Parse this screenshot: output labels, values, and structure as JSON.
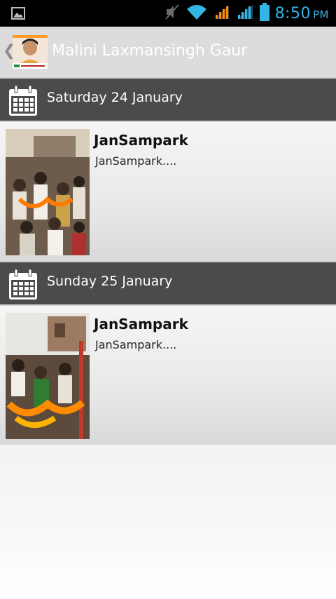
{
  "status_bar": {
    "time": "8:50",
    "ampm": "PM",
    "icons": [
      "gallery-icon",
      "mute-icon",
      "wifi-icon",
      "signal-icon-1",
      "signal-icon-2",
      "battery-icon"
    ],
    "accent_color": "#33b5e5"
  },
  "action_bar": {
    "title": "Malini Laxmansingh Gaur",
    "back_icon": "chevron-left-icon",
    "app_icon": "profile-avatar"
  },
  "feed": {
    "sections": [
      {
        "date": "Saturday 24 January",
        "posts": [
          {
            "title": "JanSampark",
            "description": "JanSampark...."
          }
        ]
      },
      {
        "date": "Sunday 25 January",
        "posts": [
          {
            "title": "JanSampark",
            "description": "JanSampark...."
          }
        ]
      }
    ]
  },
  "colors": {
    "header_bg": "#4a4b4a",
    "statusbar_bg": "#000000",
    "actionbar_bg": "#dcdcdc"
  }
}
